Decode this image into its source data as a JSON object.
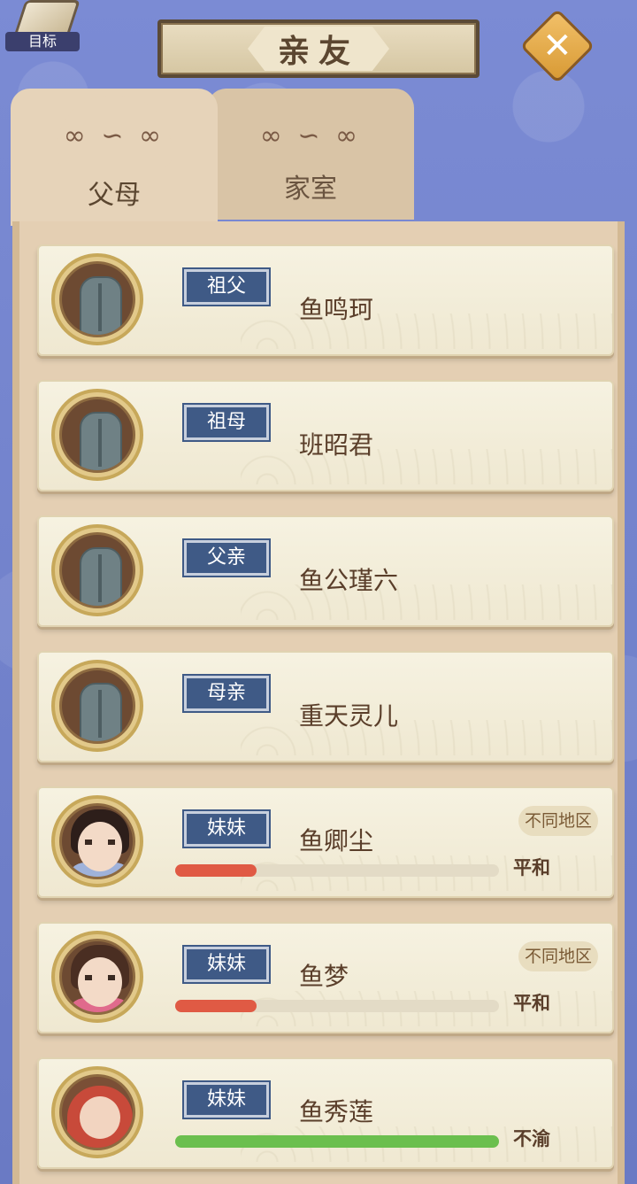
{
  "header": {
    "goal_label": "目标",
    "title": "亲友",
    "close_symbol": "✕"
  },
  "tabs": [
    {
      "label": "父母",
      "active": true
    },
    {
      "label": "家室",
      "active": false
    }
  ],
  "relatives": [
    {
      "relation": "祖父",
      "name": "鱼鸣珂",
      "avatar": "tombstone-icon"
    },
    {
      "relation": "祖母",
      "name": "班昭君",
      "avatar": "tombstone-icon"
    },
    {
      "relation": "父亲",
      "name": "鱼公瑾六",
      "avatar": "tombstone-icon"
    },
    {
      "relation": "母亲",
      "name": "重天灵儿",
      "avatar": "tombstone-icon"
    },
    {
      "relation": "妹妹",
      "name": "鱼卿尘",
      "avatar": "girl-portrait",
      "region": "不同地区",
      "mood": "平和",
      "affinity": 0.25,
      "bar_color": "#e05a44"
    },
    {
      "relation": "妹妹",
      "name": "鱼梦",
      "avatar": "girl-portrait",
      "region": "不同地区",
      "mood": "平和",
      "affinity": 0.25,
      "bar_color": "#e05a44"
    },
    {
      "relation": "妹妹",
      "name": "鱼秀莲",
      "avatar": "baby-portrait",
      "mood": "不渝",
      "affinity": 1.0,
      "bar_color": "#6bbf4e"
    }
  ],
  "colors": {
    "relation_badge": "#3f5a86",
    "panel": "#e4cfb3",
    "background": "#6f7fc9"
  }
}
